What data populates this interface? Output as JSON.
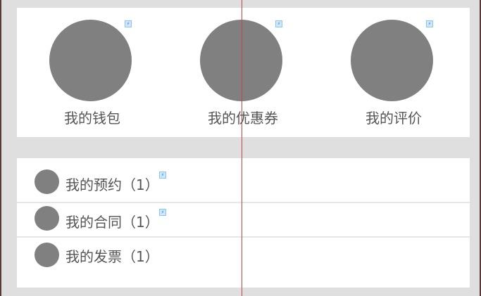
{
  "shortcuts": [
    {
      "label": "我的钱包"
    },
    {
      "label": "我的优惠券"
    },
    {
      "label": "我的评价"
    }
  ],
  "list": [
    {
      "label": "我的预约（1）",
      "badge": true
    },
    {
      "label": "我的合同（1）",
      "badge": true
    },
    {
      "label": "我的发票（1）",
      "badge": false
    }
  ],
  "badge_glyph": "⚡",
  "colors": {
    "background": "#dfdfdf",
    "card": "#ffffff",
    "placeholder_circle": "#808080",
    "text": "#555555",
    "guide_line": "#c0483a",
    "badge_bg": "#cfe8ff"
  }
}
